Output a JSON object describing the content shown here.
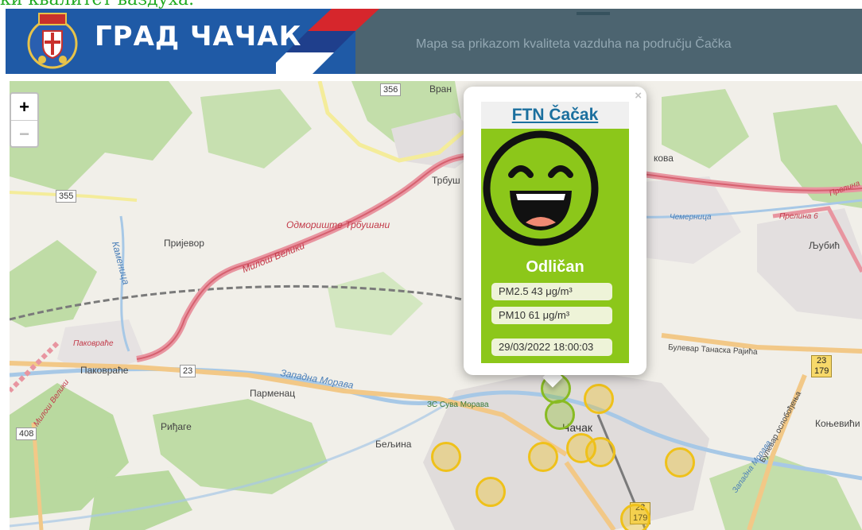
{
  "page": {
    "top_text": "ки квалитет ваздуха."
  },
  "header": {
    "brand_name": "ГРАД ЧАЧАК",
    "subtitle": "Mapa sa prikazom kvaliteta vazduha na području Čačka"
  },
  "map": {
    "zoom_in": "+",
    "zoom_out": "−",
    "labels": {
      "prijevor": "Пријевор",
      "pakovrace": "Паковраће",
      "pakovrace_exit": "Паковраће",
      "parmenac": "Парменац",
      "ridjage": "Риђаге",
      "beljina": "Бељина",
      "cacak": "Чачак",
      "trbusani": "Трбуш",
      "vranici": "Вран",
      "odmoriste": "Одмориште Трбушани",
      "milos_road": "Милош Велики",
      "milos_road_2": "Милош Велики",
      "zapadna_morava": "Западна Морава",
      "zapadna_morava_2": "Западна Морава",
      "kamenica": "Каменица",
      "cemernica": "Чемерница",
      "prelina": "Прелина",
      "prelina_exit": "Прелина 6",
      "ljubic": "Љубић",
      "kovana": "кова",
      "konjevici": "Коњевићи",
      "bulevar_tanasko": "Булевар Танаска Рајића",
      "bulevar_oslobodjenja": "Булевар ослобођења",
      "zc_suva_morava": "ЗС Сува Морава"
    },
    "road_shields": {
      "r356": "356",
      "r355": "355",
      "r23": "23",
      "r408": "408",
      "r23_179_top": "23",
      "r23_179_bottom": "179",
      "r23b_top": "23",
      "r23b_bottom": "179"
    }
  },
  "popup": {
    "close": "×",
    "station_name": "FTN Čačak",
    "status": "Odličan",
    "pm25": "PM2.5 43 μg/m³",
    "pm10": "PM10 61 μg/m³",
    "timestamp": "29/03/2022 18:00:03",
    "face_icon": "laughing-face-icon",
    "panel_color": "#8cc71a"
  },
  "markers": {
    "good_color": "#88bb22",
    "moderate_color": "#efc11a"
  }
}
